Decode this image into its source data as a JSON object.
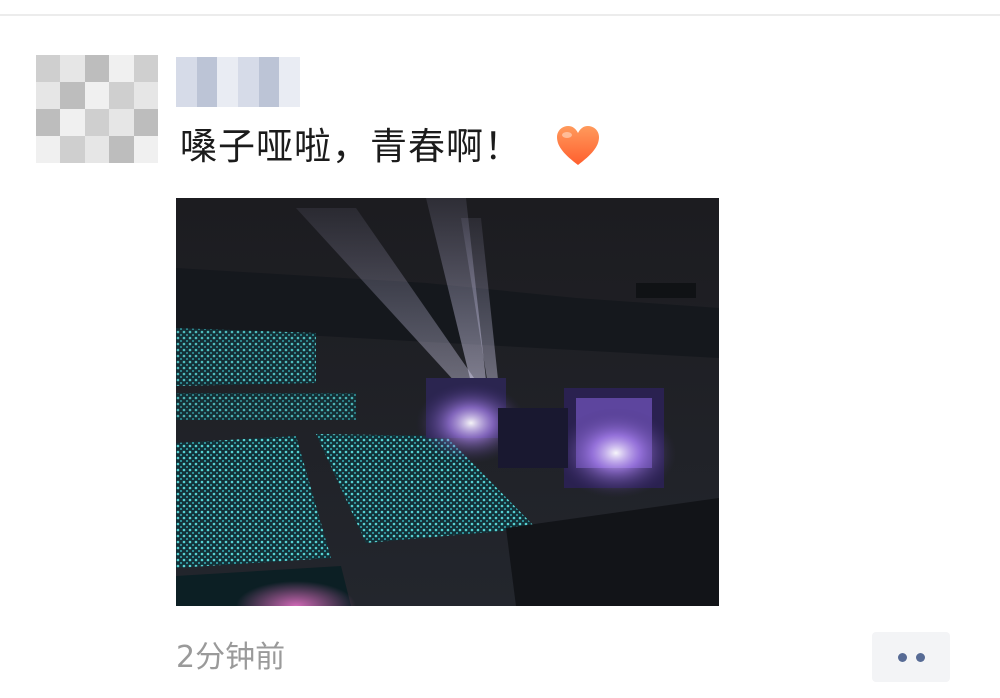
{
  "post": {
    "text": "嗓子哑啦，青春啊！",
    "emoji": "heart-icon",
    "timestamp": "2分钟前",
    "photo_alt": "concert-photo"
  },
  "colors": {
    "accent": "#576b95",
    "text": "#1b1b1b",
    "muted": "#9a9a9a",
    "heart": "#ff7a45",
    "more_bg": "#f3f4f6"
  }
}
